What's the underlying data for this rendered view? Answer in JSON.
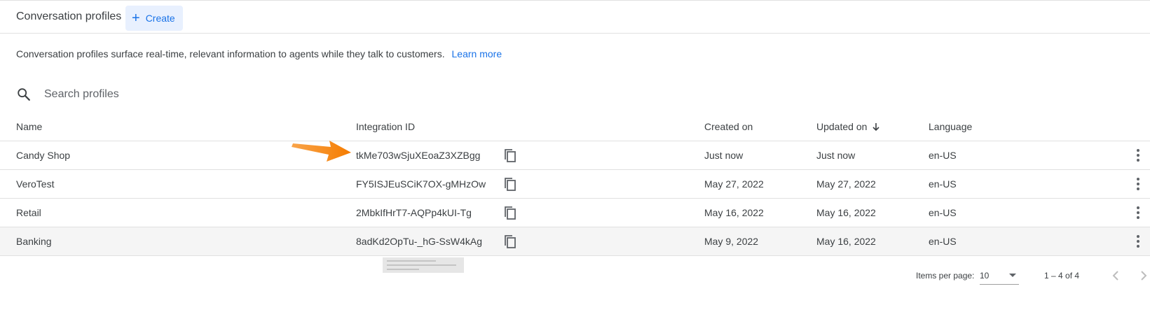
{
  "header": {
    "title": "Conversation profiles",
    "create_label": "Create"
  },
  "description": {
    "text": "Conversation profiles surface real-time, relevant information to agents while they talk to customers.",
    "link": "Learn more"
  },
  "search": {
    "placeholder": "Search profiles"
  },
  "table": {
    "columns": {
      "name": "Name",
      "integration_id": "Integration ID",
      "created_on": "Created on",
      "updated_on": "Updated on",
      "language": "Language"
    },
    "sort_icon": "arrow-down-icon",
    "rows": [
      {
        "name": "Candy Shop",
        "integration_id": "tkMe703wSjuXEoaZ3XZBgg",
        "created_on": "Just now",
        "updated_on": "Just now",
        "language": "en-US"
      },
      {
        "name": "VeroTest",
        "integration_id": "FY5ISJEuSCiK7OX-gMHzOw",
        "created_on": "May 27, 2022",
        "updated_on": "May 27, 2022",
        "language": "en-US"
      },
      {
        "name": "Retail",
        "integration_id": "2MbkIfHrT7-AQPp4kUI-Tg",
        "created_on": "May 16, 2022",
        "updated_on": "May 16, 2022",
        "language": "en-US"
      },
      {
        "name": "Banking",
        "integration_id": "8adKd2OpTu-_hG-SsW4kAg",
        "created_on": "May 9, 2022",
        "updated_on": "May 16, 2022",
        "language": "en-US"
      }
    ]
  },
  "pagination": {
    "items_per_page_label": "Items per page:",
    "items_per_page_value": "10",
    "range": "1 – 4 of 4"
  },
  "colors": {
    "accent": "#1a73e8",
    "annotation_arrow": "#f57c00"
  }
}
